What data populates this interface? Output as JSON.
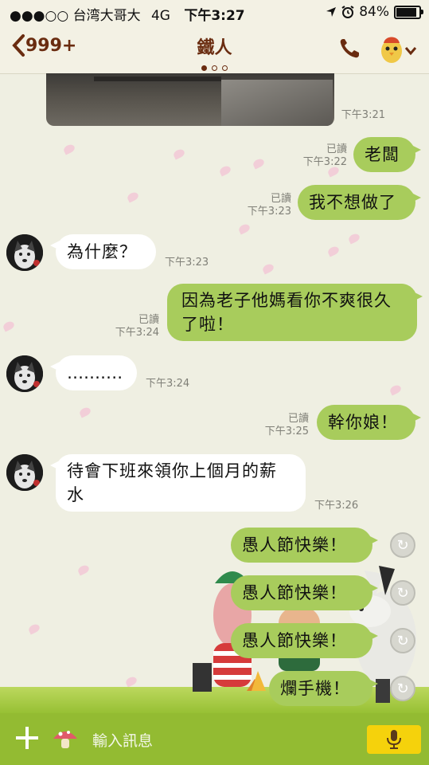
{
  "status_bar": {
    "signal": "●●●○○",
    "carrier": "台湾大哥大",
    "network": "4G",
    "time": "下午3:27",
    "battery": "84%",
    "battery_level": 0.84
  },
  "header": {
    "back_label": "999+",
    "title": "鐵人",
    "page_dots": 3,
    "active_dot": 0
  },
  "photo_message": {
    "time": "下午3:21"
  },
  "messages": [
    {
      "from": "me",
      "text": "老闆",
      "read": "已讀",
      "time": "下午3:22"
    },
    {
      "from": "me",
      "text": "我不想做了",
      "read": "已讀",
      "time": "下午3:23"
    },
    {
      "from": "them",
      "text": "為什麼？",
      "time": "下午3:23"
    },
    {
      "from": "me",
      "lines": [
        "因為老子他媽看你不爽很久",
        "了啦！"
      ],
      "read": "已讀",
      "time": "下午3:24"
    },
    {
      "from": "them",
      "text": "‥‥‥‥‥",
      "time": "下午3:24"
    },
    {
      "from": "me",
      "text": "幹你娘！",
      "read": "已讀",
      "time": "下午3:25"
    },
    {
      "from": "them",
      "lines": [
        "待會下班來領你上個月的薪",
        "水"
      ],
      "time": "下午3:26"
    },
    {
      "from": "me",
      "text": "愚人節快樂！",
      "status": "failed"
    },
    {
      "from": "me",
      "text": "愚人節快樂！",
      "status": "failed"
    },
    {
      "from": "me",
      "text": "愚人節快樂！",
      "status": "failed"
    },
    {
      "from": "me",
      "text": "爛手機！",
      "status": "failed"
    }
  ],
  "input": {
    "placeholder": "輸入訊息"
  },
  "colors": {
    "header_brown": "#6a2c10",
    "my_bubble": "#a8cc5c",
    "their_bubble": "#ffffff",
    "input_bar": "#93bb32",
    "mic_button": "#f5d20c"
  },
  "icons": {
    "back": "chevron-left-icon",
    "call": "phone-icon",
    "menu": "chevron-down-icon",
    "add": "plus-icon",
    "sticker": "mushroom-icon",
    "voice": "microphone-icon",
    "retry": "refresh-icon"
  }
}
